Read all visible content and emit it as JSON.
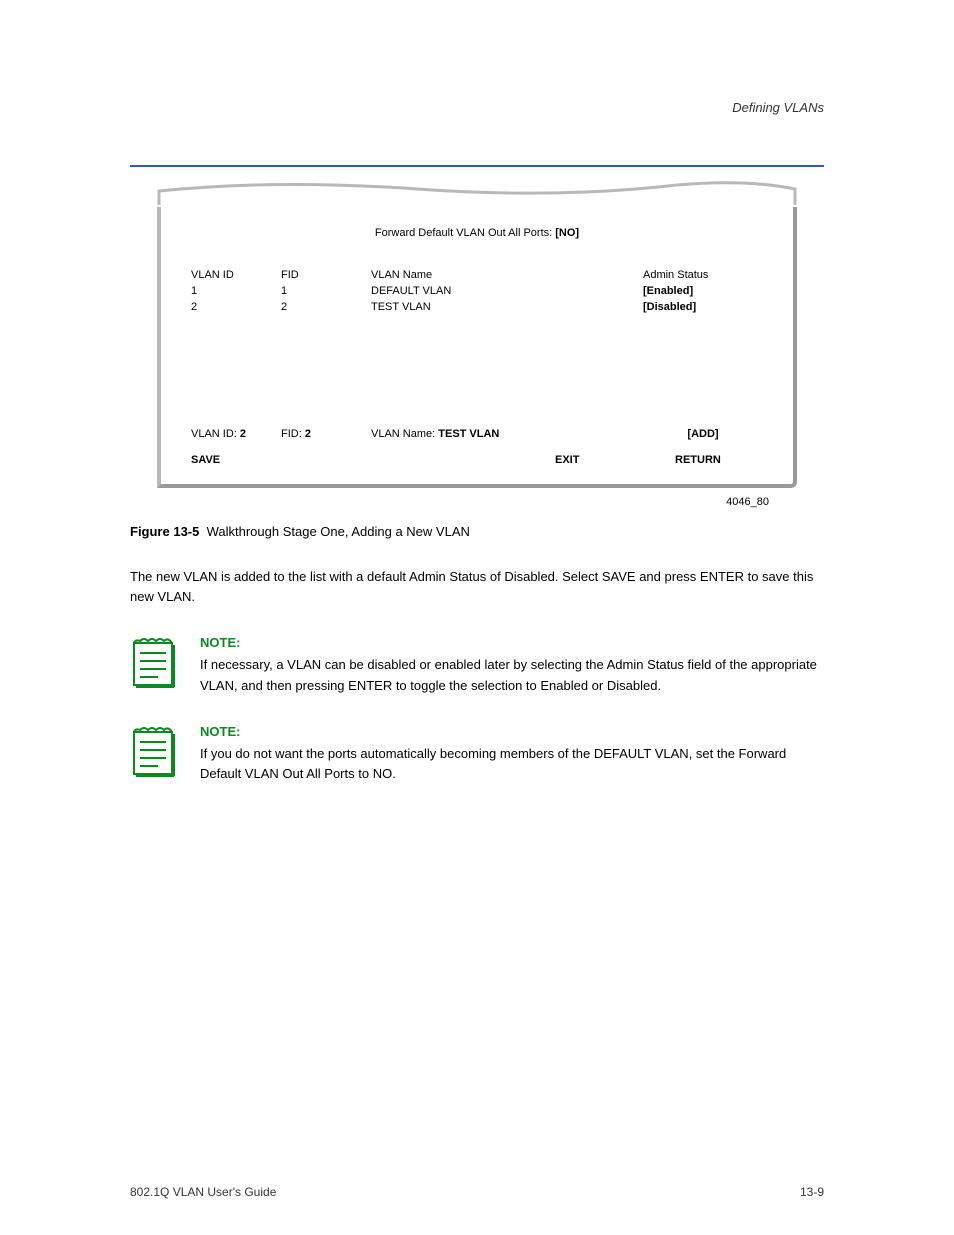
{
  "header": {
    "breadcrumb": "Defining VLANs"
  },
  "panel": {
    "forward_label": "Forward Default VLAN Out All Ports:",
    "forward_value": "[NO]",
    "columns": {
      "vlan_id": "VLAN ID",
      "fid": "FID",
      "vlan_name": "VLAN Name",
      "admin_status": "Admin Status"
    },
    "rows": [
      {
        "vlan_id": "1",
        "fid": "1",
        "vlan_name": "DEFAULT VLAN",
        "admin_status": "[Enabled]"
      },
      {
        "vlan_id": "2",
        "fid": "2",
        "vlan_name": "TEST VLAN",
        "admin_status": "[Disabled]"
      }
    ],
    "lower": {
      "vlan_id_label": "VLAN ID:",
      "vlan_id_value": "2",
      "fid_label": "FID:",
      "fid_value": "2",
      "name_label": "VLAN Name:",
      "name_value": "TEST VLAN",
      "add_label": "[ADD]"
    },
    "buttons": {
      "save": "SAVE",
      "exit": "EXIT",
      "return_": "RETURN"
    }
  },
  "figure_id": "4046_80",
  "figcap": {
    "lead": "Figure 13-5",
    "text": "Walkthrough Stage One, Adding a New VLAN"
  },
  "para1": "The new VLAN is added to the list with a default Admin Status of Disabled. Select SAVE and press ENTER to save this new VLAN.",
  "notes": [
    {
      "label": "NOTE:",
      "text": "If necessary, a VLAN can be disabled or enabled later by selecting the Admin Status field of the appropriate VLAN, and then pressing ENTER to toggle the selection to Enabled or Disabled."
    },
    {
      "label": "NOTE:",
      "text": "If you do not want the ports automatically becoming members of the DEFAULT VLAN, set the Forward Default VLAN Out All Ports to NO."
    }
  ],
  "footer": {
    "left": "802.1Q VLAN User's Guide",
    "right": "13-9"
  }
}
